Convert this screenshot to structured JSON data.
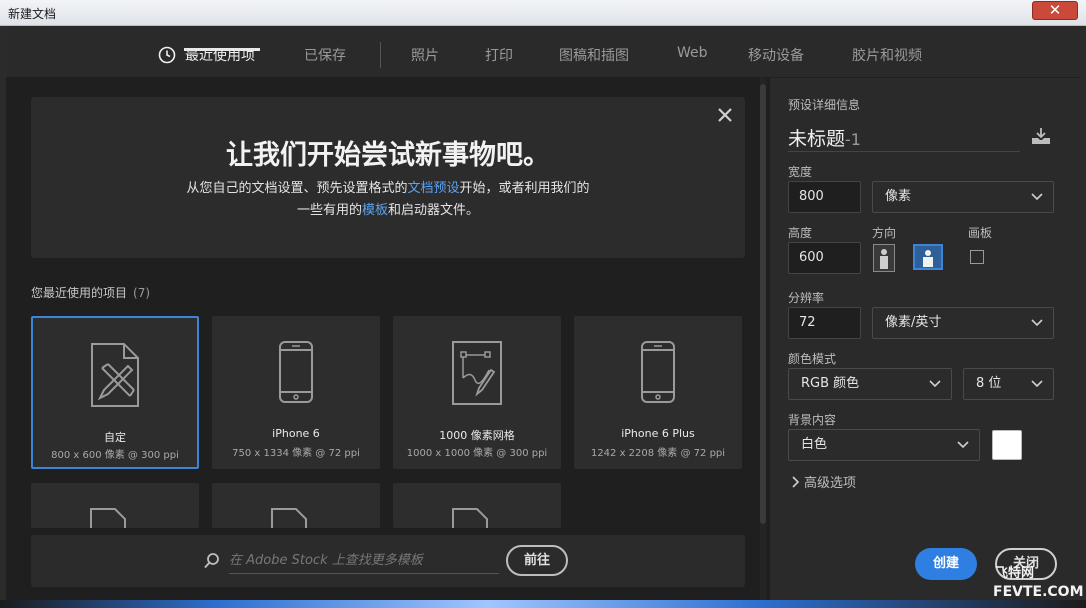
{
  "window": {
    "title": "新建文档",
    "close_glyph": "✕"
  },
  "tabs": [
    {
      "label": "最近使用项"
    },
    {
      "label": "已保存"
    },
    {
      "label": "照片"
    },
    {
      "label": "打印"
    },
    {
      "label": "图稿和插图"
    },
    {
      "label": "Web"
    },
    {
      "label": "移动设备"
    },
    {
      "label": "胶片和视频"
    }
  ],
  "hero": {
    "title": "让我们开始尝试新事物吧。",
    "line1_pre": "从您自己的文档设置、预先设置格式的",
    "line1_link": "文档预设",
    "line1_post": "开始，或者利用我们的",
    "line2_pre": "一些有用的",
    "line2_link": "模板",
    "line2_post": "和启动器文件。"
  },
  "recent": {
    "title": "您最近使用的项目",
    "count": "(7)"
  },
  "cards": [
    {
      "name": "自定",
      "meta": "800 x 600 像素 @ 300 ppi",
      "icon": "custom-document-icon",
      "selected": true
    },
    {
      "name": "iPhone 6",
      "meta": "750 x 1334 像素 @ 72 ppi",
      "icon": "phone-icon",
      "selected": false
    },
    {
      "name": "1000 像素网格",
      "meta": "1000 x 1000 像素 @ 300 ppi",
      "icon": "grid-document-icon",
      "selected": false
    },
    {
      "name": "iPhone 6 Plus",
      "meta": "1242 x 2208 像素 @ 72 ppi",
      "icon": "phone-icon",
      "selected": false
    }
  ],
  "search": {
    "placeholder": "在 Adobe Stock 上查找更多模板",
    "go_label": "前往"
  },
  "preset": {
    "section_title": "预设详细信息",
    "doc_name": "未标题",
    "doc_suffix": "-1",
    "width_label": "宽度",
    "width_value": "800",
    "width_unit": "像素",
    "height_label": "高度",
    "height_value": "600",
    "orientation_label": "方向",
    "artboard_label": "画板",
    "resolution_label": "分辨率",
    "resolution_value": "72",
    "resolution_unit": "像素/英寸",
    "color_mode_label": "颜色模式",
    "color_mode": "RGB 颜色",
    "bit_depth": "8 位",
    "bg_label": "背景内容",
    "bg_value": "白色",
    "advanced_label": "高级选项"
  },
  "actions": {
    "create_label": "创建",
    "close_label": "关闭"
  },
  "watermark": {
    "line1": "飞特网",
    "line2": "FEVTE.COM"
  },
  "colors": {
    "accent": "#2f7ee2",
    "link": "#5aa3f2",
    "panel": "#2a2a2a"
  }
}
